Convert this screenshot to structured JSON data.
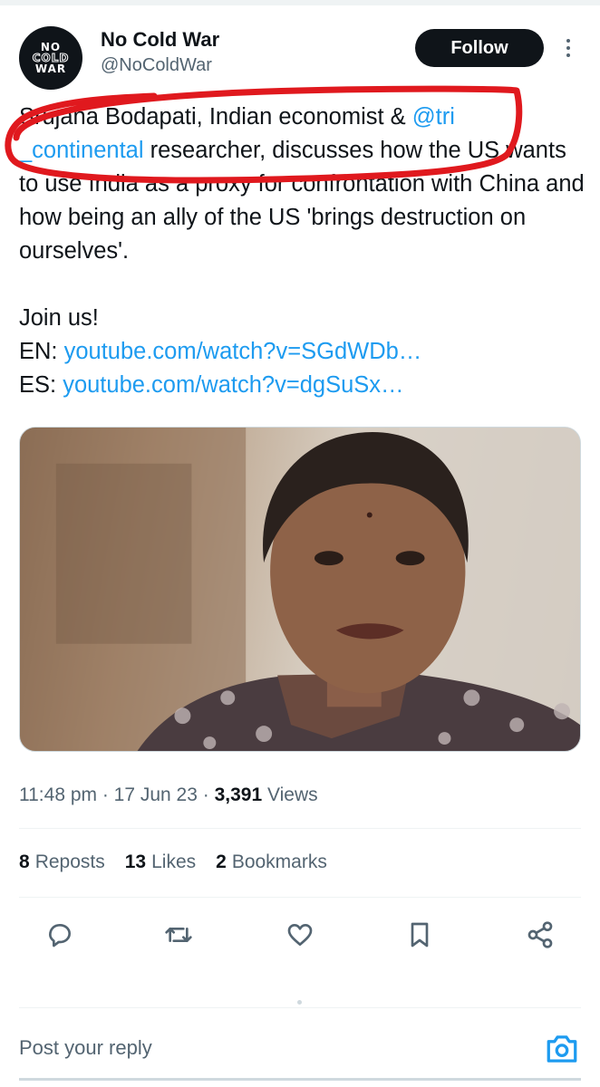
{
  "tweet": {
    "author": {
      "display_name": "No Cold War",
      "handle": "@NoColdWar",
      "avatar_lines": [
        "NO",
        "COLD",
        "WAR"
      ]
    },
    "follow_label": "Follow",
    "text_part1": "Srujana Bodapati, Indian economist & ",
    "mention": "@tri\n_continental",
    "text_part2": " researcher, discusses how the US wants to use India as a proxy for confrontation with China and how being an ally of the US 'brings destruction on ourselves'.\n\nJoin us!\nEN: ",
    "link_en": "youtube.com/watch?v=SGdWDb…",
    "text_part3": "\nES: ",
    "link_es": "youtube.com/watch?v=dgSuSx…",
    "time": "11:48 pm",
    "date": "17 Jun 23",
    "views_count": "3,391",
    "views_label": "Views",
    "reposts_count": "8",
    "reposts_label": "Reposts",
    "likes_count": "13",
    "likes_label": "Likes",
    "bookmarks_count": "2",
    "bookmarks_label": "Bookmarks"
  },
  "reply": {
    "placeholder": "Post your reply"
  },
  "colors": {
    "accent": "#1d9bf0",
    "text": "#0f1419",
    "muted": "#536471",
    "annotation": "#e0191e"
  },
  "icons": [
    "more-icon",
    "reply-icon",
    "repost-icon",
    "like-icon",
    "bookmark-icon",
    "share-icon",
    "camera-icon"
  ]
}
